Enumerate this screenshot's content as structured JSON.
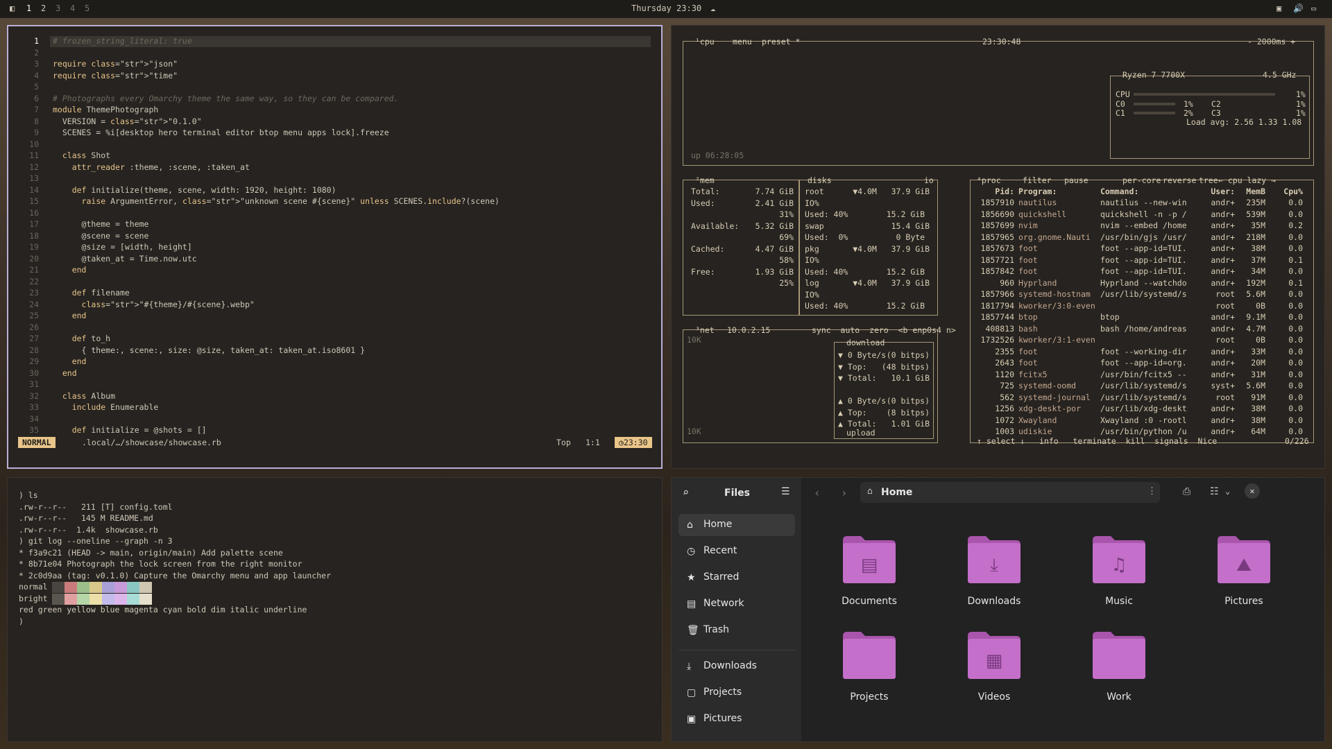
{
  "topbar": {
    "workspaces": [
      "1",
      "2",
      "3",
      "4",
      "5"
    ],
    "clock": "Thursday 23:30"
  },
  "editor": {
    "lines": [
      {
        "n": "1",
        "t": "# frozen_string_literal: true"
      },
      {
        "n": "2",
        "t": ""
      },
      {
        "n": "3",
        "t": "require \"json\""
      },
      {
        "n": "4",
        "t": "require \"time\""
      },
      {
        "n": "5",
        "t": ""
      },
      {
        "n": "6",
        "t": "# Photographs every Omarchy theme the same way, so they can be compared."
      },
      {
        "n": "7",
        "t": "module ThemePhotograph"
      },
      {
        "n": "8",
        "t": "  VERSION = \"0.1.0\""
      },
      {
        "n": "9",
        "t": "  SCENES = %i[desktop hero terminal editor btop menu apps lock].freeze"
      },
      {
        "n": "10",
        "t": ""
      },
      {
        "n": "11",
        "t": "  class Shot"
      },
      {
        "n": "12",
        "t": "    attr_reader :theme, :scene, :taken_at"
      },
      {
        "n": "13",
        "t": ""
      },
      {
        "n": "14",
        "t": "    def initialize(theme, scene, width: 1920, height: 1080)"
      },
      {
        "n": "15",
        "t": "      raise ArgumentError, \"unknown scene #{scene}\" unless SCENES.include?(scene)"
      },
      {
        "n": "16",
        "t": ""
      },
      {
        "n": "17",
        "t": "      @theme = theme"
      },
      {
        "n": "18",
        "t": "      @scene = scene"
      },
      {
        "n": "19",
        "t": "      @size = [width, height]"
      },
      {
        "n": "20",
        "t": "      @taken_at = Time.now.utc"
      },
      {
        "n": "21",
        "t": "    end"
      },
      {
        "n": "22",
        "t": ""
      },
      {
        "n": "23",
        "t": "    def filename"
      },
      {
        "n": "24",
        "t": "      \"#{theme}/#{scene}.webp\""
      },
      {
        "n": "25",
        "t": "    end"
      },
      {
        "n": "26",
        "t": ""
      },
      {
        "n": "27",
        "t": "    def to_h"
      },
      {
        "n": "28",
        "t": "      { theme:, scene:, size: @size, taken_at: taken_at.iso8601 }"
      },
      {
        "n": "29",
        "t": "    end"
      },
      {
        "n": "30",
        "t": "  end"
      },
      {
        "n": "31",
        "t": ""
      },
      {
        "n": "32",
        "t": "  class Album"
      },
      {
        "n": "33",
        "t": "    include Enumerable"
      },
      {
        "n": "34",
        "t": ""
      },
      {
        "n": "35",
        "t": "    def initialize = @shots = []"
      }
    ],
    "status": {
      "mode": "NORMAL",
      "file": ".local/…/showcase/showcase.rb",
      "position": "Top",
      "cursor": "1:1",
      "time": "23:30"
    }
  },
  "btop": {
    "cpu_header": [
      "¹cpu",
      "menu",
      "preset *"
    ],
    "clock": "23:30:48",
    "interval": "- 2000ms +",
    "uptime": "up 06:28:05",
    "cpu_model": "Ryzen 7 7700X",
    "freq": "4.5 GHz",
    "cpu_rows": [
      {
        "a": "CPU",
        "v": "1%"
      },
      {
        "a": "C0",
        "v": "1%",
        "b": "C2",
        "w": "1%"
      },
      {
        "a": "C1",
        "v": "2%",
        "b": "C3",
        "w": "1%"
      }
    ],
    "load": "Load avg: 2.56 1.33 1.08",
    "mem": {
      "title": "²mem",
      "rows": [
        {
          "k": "Total:",
          "v": "7.74 GiB"
        },
        {
          "k": "Used:",
          "v": "2.41 GiB"
        },
        {
          "k": "",
          "v": "31%"
        },
        {
          "k": "Available:",
          "v": "5.32 GiB"
        },
        {
          "k": "",
          "v": "69%"
        },
        {
          "k": "Cached:",
          "v": "4.47 GiB"
        },
        {
          "k": "",
          "v": "58%"
        },
        {
          "k": "Free:",
          "v": "1.93 GiB"
        },
        {
          "k": "",
          "v": "25%"
        }
      ]
    },
    "disks": {
      "title": "disks",
      "io": "io",
      "rows": [
        "root      ▼4.0M   37.9 GiB",
        "IO%",
        "Used: 40%        15.2 GiB",
        "swap              15.4 GiB",
        "Used:  0%          0 Byte",
        "pkg       ▼4.0M   37.9 GiB",
        "IO%",
        "Used: 40%        15.2 GiB",
        "log       ▼4.0M   37.9 GiB",
        "IO%",
        "Used: 40%        15.2 GiB"
      ]
    },
    "proc": {
      "header": [
        "⁴proc",
        "filter",
        "pause",
        "per-core",
        "reverse",
        "tree",
        "← cpu lazy →"
      ],
      "columns": [
        "Pid:",
        "Program:",
        "Command:",
        "User:",
        "MemB",
        "Cpu%"
      ],
      "rows": [
        [
          "1857910",
          "nautilus",
          "nautilus --new-win",
          "andr+",
          "235M",
          "0.0"
        ],
        [
          "1856690",
          "quickshell",
          "quickshell -n -p /",
          "andr+",
          "539M",
          "0.0"
        ],
        [
          "1857699",
          "nvim",
          "nvim --embed /home",
          "andr+",
          "35M",
          "0.2"
        ],
        [
          "1857965",
          "org.gnome.Nauti",
          "/usr/bin/gjs /usr/",
          "andr+",
          "218M",
          "0.0"
        ],
        [
          "1857673",
          "foot",
          "foot --app-id=TUI.",
          "andr+",
          "38M",
          "0.0"
        ],
        [
          "1857721",
          "foot",
          "foot --app-id=TUI.",
          "andr+",
          "37M",
          "0.1"
        ],
        [
          "1857842",
          "foot",
          "foot --app-id=TUI.",
          "andr+",
          "34M",
          "0.0"
        ],
        [
          "960",
          "Hyprland",
          "Hyprland --watchdo",
          "andr+",
          "192M",
          "0.1"
        ],
        [
          "1857966",
          "systemd-hostnam",
          "/usr/lib/systemd/s",
          "root",
          "5.6M",
          "0.0"
        ],
        [
          "1817794",
          "kworker/3:0-even",
          "",
          "root",
          "0B",
          "0.0"
        ],
        [
          "1857744",
          "btop",
          "btop",
          "andr+",
          "9.1M",
          "0.0"
        ],
        [
          "408813",
          "bash",
          "bash /home/andreas",
          "andr+",
          "4.7M",
          "0.0"
        ],
        [
          "1732526",
          "kworker/3:1-even",
          "",
          "root",
          "0B",
          "0.0"
        ],
        [
          "2355",
          "foot",
          "foot --working-dir",
          "andr+",
          "33M",
          "0.0"
        ],
        [
          "2643",
          "foot",
          "foot --app-id=org.",
          "andr+",
          "20M",
          "0.0"
        ],
        [
          "1120",
          "fcitx5",
          "/usr/bin/fcitx5 --",
          "andr+",
          "31M",
          "0.0"
        ],
        [
          "725",
          "systemd-oomd",
          "/usr/lib/systemd/s",
          "syst+",
          "5.6M",
          "0.0"
        ],
        [
          "562",
          "systemd-journal",
          "/usr/lib/systemd/s",
          "root",
          "91M",
          "0.0"
        ],
        [
          "1256",
          "xdg-deskt-por",
          "/usr/lib/xdg-deskt",
          "andr+",
          "38M",
          "0.0"
        ],
        [
          "1072",
          "Xwayland",
          "Xwayland :0 -rootl",
          "andr+",
          "38M",
          "0.0"
        ],
        [
          "1003",
          "udiskie",
          "/usr/bin/python /u",
          "andr+",
          "64M",
          "0.0"
        ]
      ],
      "footer": "↑ select ↓   info   terminate  kill  signals  Nice",
      "count": "0/226"
    },
    "net": {
      "title": "³net",
      "ip": "10.0.2.15",
      "opts": "sync  auto  zero  <b enp0s4 n>",
      "scale_top": "10K",
      "scale_bot": "10K",
      "download": "download",
      "rows": [
        {
          "k": "▼ 0 Byte/s",
          "v": "(0 bitps)"
        },
        {
          "k": "▼ Top:",
          "v": "(48 bitps)"
        },
        {
          "k": "▼ Total:",
          "v": "10.1 GiB"
        },
        {
          "k": "▲ 0 Byte/s",
          "v": "(0 bitps)"
        },
        {
          "k": "▲ Top:",
          "v": "(8 bitps)"
        },
        {
          "k": "▲ Total:",
          "v": "1.01 GiB"
        }
      ],
      "upload": "upload"
    }
  },
  "terminal": {
    "lines": [
      ") ls",
      ".rw-r--r--   211 [T] config.toml",
      ".rw-r--r--   145 M README.md",
      ".rw-r--r--  1.4k  showcase.rb",
      ") git log --oneline --graph -n 3",
      "* f3a9c21 (HEAD -> main, origin/main) Add palette scene",
      "* 8b71e04 Photograph the lock screen from the right monitor",
      "* 2c0d9aa (tag: v0.1.0) Capture the Omarchy menu and app launcher",
      "normal",
      "bright",
      "red green yellow blue magenta cyan bold dim italic underline",
      ")"
    ],
    "palette_normal": [
      "#4a4540",
      "#c97b7b",
      "#9bbf8a",
      "#d8c98a",
      "#a9a0d8",
      "#c79ad8",
      "#8ac7c2",
      "#cfc6b0"
    ],
    "palette_bright": [
      "#5a554e",
      "#e0a0a0",
      "#b5d6a6",
      "#ece0a8",
      "#c3bbea",
      "#dcb6ea",
      "#a8dcd6",
      "#e6dfcc"
    ]
  },
  "files": {
    "title": "Files",
    "location": "Home",
    "sidebar": [
      "Home",
      "Recent",
      "Starred",
      "Network",
      "Trash",
      "Downloads",
      "Projects",
      "Pictures"
    ],
    "folders": [
      "Documents",
      "Downloads",
      "Music",
      "Pictures",
      "Projects",
      "Videos",
      "Work"
    ],
    "accent": "#c46fc9"
  }
}
